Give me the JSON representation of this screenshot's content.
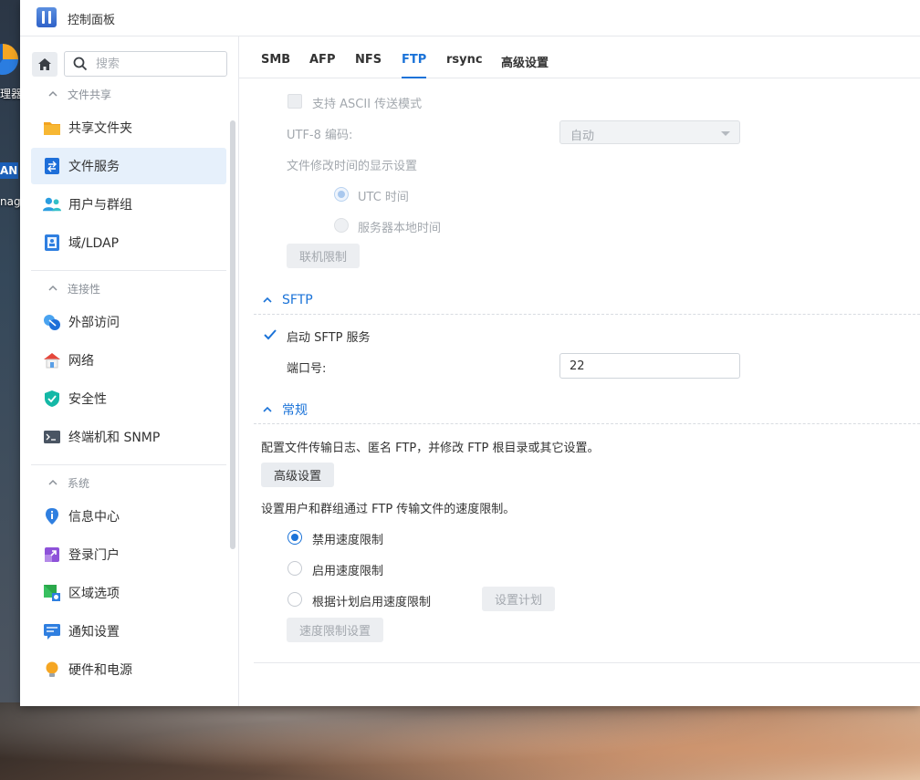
{
  "desktop": {
    "label_top": "理器",
    "label_an": "AN",
    "label_bottom": "nag"
  },
  "window": {
    "title": "控制面板"
  },
  "sidebar": {
    "search_placeholder": "搜索",
    "sections": [
      {
        "title": "文件共享",
        "items": [
          {
            "label": "共享文件夹",
            "icon": "folder-icon"
          },
          {
            "label": "文件服务",
            "icon": "file-services-icon",
            "active": true
          },
          {
            "label": "用户与群组",
            "icon": "users-icon"
          },
          {
            "label": "域/LDAP",
            "icon": "domain-icon"
          }
        ]
      },
      {
        "title": "连接性",
        "items": [
          {
            "label": "外部访问",
            "icon": "external-access-icon"
          },
          {
            "label": "网络",
            "icon": "network-icon"
          },
          {
            "label": "安全性",
            "icon": "shield-icon"
          },
          {
            "label": "终端机和 SNMP",
            "icon": "terminal-icon"
          }
        ]
      },
      {
        "title": "系统",
        "items": [
          {
            "label": "信息中心",
            "icon": "info-center-icon"
          },
          {
            "label": "登录门户",
            "icon": "login-portal-icon"
          },
          {
            "label": "区域选项",
            "icon": "regional-options-icon"
          },
          {
            "label": "通知设置",
            "icon": "notification-icon"
          },
          {
            "label": "硬件和电源",
            "icon": "hardware-power-icon"
          }
        ]
      }
    ]
  },
  "tabs": [
    {
      "label": "SMB"
    },
    {
      "label": "AFP"
    },
    {
      "label": "NFS"
    },
    {
      "label": "FTP",
      "active": true
    },
    {
      "label": "rsync"
    },
    {
      "label": "高级设置"
    }
  ],
  "ftp": {
    "ascii_mode_label": "支持 ASCII 传送模式",
    "utf8_label": "UTF-8 编码:",
    "utf8_value": "自动",
    "mtime_label": "文件修改时间的显示设置",
    "mtime_options": [
      "UTC 时间",
      "服务器本地时间"
    ],
    "conn_limit_button": "联机限制"
  },
  "sftp": {
    "title": "SFTP",
    "enable_label": "启动 SFTP 服务",
    "port_label": "端口号:",
    "port_value": "22"
  },
  "general": {
    "title": "常规",
    "desc1": "配置文件传输日志、匿名 FTP，并修改 FTP 根目录或其它设置。",
    "advanced_button": "高级设置",
    "desc2": "设置用户和群组通过 FTP 传输文件的速度限制。",
    "speed_options": [
      "禁用速度限制",
      "启用速度限制",
      "根据计划启用速度限制"
    ],
    "schedule_button": "设置计划",
    "speed_settings_button": "速度限制设置"
  },
  "colors": {
    "accent": "#1b73d8",
    "active_bg": "#e6f0fb"
  }
}
